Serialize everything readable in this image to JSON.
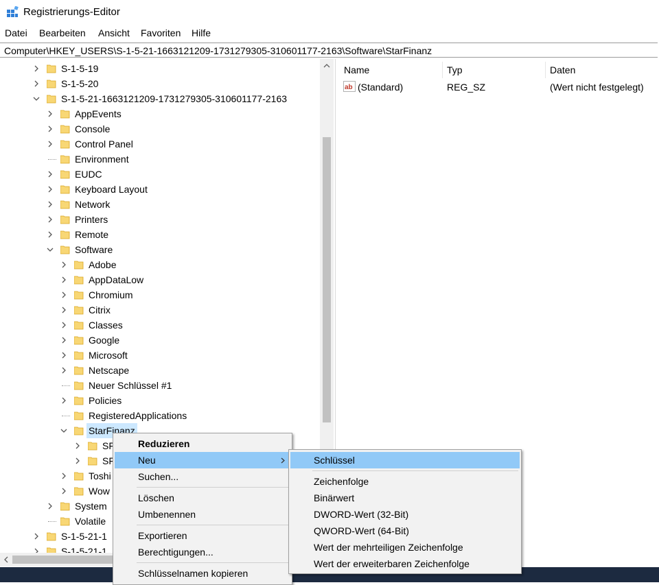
{
  "window": {
    "title": "Registrierungs-Editor"
  },
  "menubar": [
    "Datei",
    "Bearbeiten",
    "Ansicht",
    "Favoriten",
    "Hilfe"
  ],
  "address": "Computer\\HKEY_USERS\\S-1-5-21-1663121209-1731279305-310601177-2163\\Software\\StarFinanz",
  "tree": [
    {
      "label": "S-1-5-19",
      "expand": "collapsed"
    },
    {
      "label": "S-1-5-20",
      "expand": "collapsed"
    },
    {
      "label": "S-1-5-21-1663121209-1731279305-310601177-2163",
      "expand": "expanded"
    },
    {
      "label": "AppEvents",
      "expand": "collapsed"
    },
    {
      "label": "Console",
      "expand": "collapsed"
    },
    {
      "label": "Control Panel",
      "expand": "collapsed"
    },
    {
      "label": "Environment",
      "expand": "none"
    },
    {
      "label": "EUDC",
      "expand": "collapsed"
    },
    {
      "label": "Keyboard Layout",
      "expand": "collapsed"
    },
    {
      "label": "Network",
      "expand": "collapsed"
    },
    {
      "label": "Printers",
      "expand": "collapsed"
    },
    {
      "label": "Remote",
      "expand": "collapsed"
    },
    {
      "label": "Software",
      "expand": "expanded"
    },
    {
      "label": "Adobe",
      "expand": "collapsed"
    },
    {
      "label": "AppDataLow",
      "expand": "collapsed"
    },
    {
      "label": "Chromium",
      "expand": "collapsed"
    },
    {
      "label": "Citrix",
      "expand": "collapsed"
    },
    {
      "label": "Classes",
      "expand": "collapsed"
    },
    {
      "label": "Google",
      "expand": "collapsed"
    },
    {
      "label": "Microsoft",
      "expand": "collapsed"
    },
    {
      "label": "Netscape",
      "expand": "collapsed"
    },
    {
      "label": "Neuer Schlüssel #1",
      "expand": "none"
    },
    {
      "label": "Policies",
      "expand": "collapsed"
    },
    {
      "label": "RegisteredApplications",
      "expand": "none"
    },
    {
      "label": "StarFinanz",
      "expand": "expanded",
      "selected": true
    },
    {
      "label": "SF",
      "expand": "collapsed"
    },
    {
      "label": "SF",
      "expand": "collapsed"
    },
    {
      "label": "Toshi",
      "expand": "collapsed"
    },
    {
      "label": "Wow",
      "expand": "collapsed"
    },
    {
      "label": "System",
      "expand": "collapsed"
    },
    {
      "label": "Volatile",
      "expand": "none"
    },
    {
      "label": "S-1-5-21-1",
      "expand": "collapsed"
    },
    {
      "label": "S-1-5-21-1",
      "expand": "collapsed"
    }
  ],
  "list": {
    "headers": {
      "name": "Name",
      "type": "Typ",
      "data": "Daten"
    },
    "rows": [
      {
        "icon": "string-value-icon",
        "name": "(Standard)",
        "type": "REG_SZ",
        "data": "(Wert nicht festgelegt)"
      }
    ]
  },
  "context_menu": {
    "collapse": "Reduzieren",
    "new": "Neu",
    "find": "Suchen...",
    "delete": "Löschen",
    "rename": "Umbenennen",
    "export": "Exportieren",
    "permissions": "Berechtigungen...",
    "copy_name": "Schlüsselnamen kopieren"
  },
  "submenu": {
    "key": "Schlüssel",
    "string": "Zeichenfolge",
    "binary": "Binärwert",
    "dword": "DWORD-Wert (32-Bit)",
    "qword": "QWORD-Wert (64-Bit)",
    "multi_string": "Wert der mehrteiligen Zeichenfolge",
    "expand_string": "Wert der erweiterbaren Zeichenfolge"
  },
  "colors": {
    "highlight": "#91c9f7",
    "selected_tree": "#cce8ff",
    "folder": "#f8d775",
    "taskbar": "#1c2a40"
  }
}
